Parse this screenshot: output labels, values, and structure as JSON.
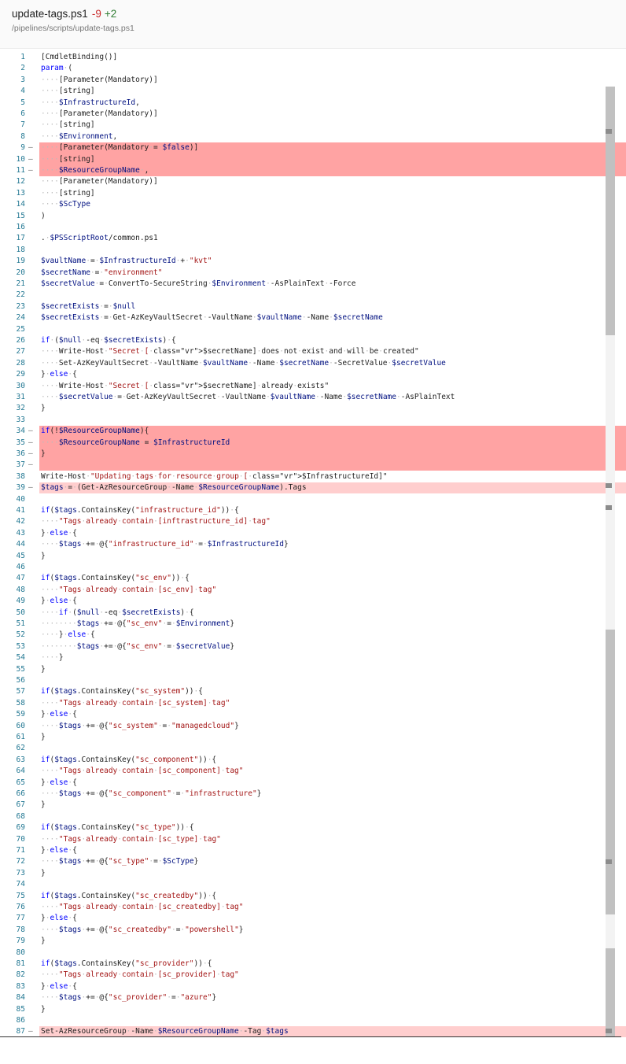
{
  "header": {
    "file_name": "update-tags.ps1",
    "deletions": "-9",
    "additions": "+2",
    "file_path": "/pipelines/scripts/update-tags.ps1"
  },
  "diff": {
    "marker_symbol": "—",
    "lines": [
      {
        "n": "1",
        "t": "[CmdletBinding()]"
      },
      {
        "n": "2",
        "t": "param ("
      },
      {
        "n": "3",
        "t": "    [Parameter(Mandatory)]"
      },
      {
        "n": "4",
        "t": "    [string]"
      },
      {
        "n": "5",
        "t": "    $InfrastructureId,"
      },
      {
        "n": "6",
        "t": "    [Parameter(Mandatory)]"
      },
      {
        "n": "7",
        "t": "    [string]"
      },
      {
        "n": "8",
        "t": "    $Environment,"
      },
      {
        "n": "9",
        "t": "    [Parameter(Mandatory = $false)]",
        "d": 1
      },
      {
        "n": "10",
        "t": "    [string]",
        "d": 1
      },
      {
        "n": "11",
        "t": "    $ResourceGroupName ,",
        "d": 1
      },
      {
        "n": "12",
        "t": "    [Parameter(Mandatory)]"
      },
      {
        "n": "13",
        "t": "    [string]"
      },
      {
        "n": "14",
        "t": "    $ScType"
      },
      {
        "n": "15",
        "t": ")"
      },
      {
        "n": "16",
        "t": ""
      },
      {
        "n": "17",
        "t": ". $PSScriptRoot/common.ps1"
      },
      {
        "n": "18",
        "t": ""
      },
      {
        "n": "19",
        "t": "$vaultName = $InfrastructureId + \"kvt\""
      },
      {
        "n": "20",
        "t": "$secretName = \"environment\""
      },
      {
        "n": "21",
        "t": "$secretValue = ConvertTo-SecureString $Environment -AsPlainText -Force"
      },
      {
        "n": "22",
        "t": ""
      },
      {
        "n": "23",
        "t": "$secretExists = $null"
      },
      {
        "n": "24",
        "t": "$secretExists = Get-AzKeyVaultSecret -VaultName $vaultName -Name $secretName"
      },
      {
        "n": "25",
        "t": ""
      },
      {
        "n": "26",
        "t": "if ($null -eq $secretExists) {"
      },
      {
        "n": "27",
        "t": "    Write-Host \"Secret [$secretName] does not exist and will be created\""
      },
      {
        "n": "28",
        "t": "    Set-AzKeyVaultSecret -VaultName $vaultName -Name $secretName -SecretValue $secretValue"
      },
      {
        "n": "29",
        "t": "} else {"
      },
      {
        "n": "30",
        "t": "    Write-Host \"Secret [$secretName] already exists\""
      },
      {
        "n": "31",
        "t": "    $secretValue = Get-AzKeyVaultSecret -VaultName $vaultName -Name $secretName -AsPlainText"
      },
      {
        "n": "32",
        "t": "}"
      },
      {
        "n": "33",
        "t": ""
      },
      {
        "n": "34",
        "t": "if(!$ResourceGroupName){",
        "d": 1
      },
      {
        "n": "35",
        "t": "    $ResourceGroupName = $InfrastructureId",
        "d": 1
      },
      {
        "n": "36",
        "t": "}",
        "d": 1
      },
      {
        "n": "37",
        "t": "",
        "d": 1
      },
      {
        "n": "38",
        "t": "Write-Host \"Updating tags for resource group [$InfrastructureId]\""
      },
      {
        "n": "39",
        "t": "$tags = (Get-AzResourceGroup -Name $ResourceGroupName).Tags",
        "d": 2
      },
      {
        "n": "40",
        "t": ""
      },
      {
        "n": "41",
        "t": "if($tags.ContainsKey(\"infrastructure_id\")) {"
      },
      {
        "n": "42",
        "t": "    \"Tags already contain [inftrastructure_id] tag\""
      },
      {
        "n": "43",
        "t": "} else {"
      },
      {
        "n": "44",
        "t": "    $tags += @{\"infrastructure_id\" = $InfrastructureId}"
      },
      {
        "n": "45",
        "t": "}"
      },
      {
        "n": "46",
        "t": ""
      },
      {
        "n": "47",
        "t": "if($tags.ContainsKey(\"sc_env\")) {"
      },
      {
        "n": "48",
        "t": "    \"Tags already contain [sc_env] tag\""
      },
      {
        "n": "49",
        "t": "} else {"
      },
      {
        "n": "50",
        "t": "    if ($null -eq $secretExists) {"
      },
      {
        "n": "51",
        "t": "        $tags += @{\"sc_env\" = $Environment}"
      },
      {
        "n": "52",
        "t": "    } else {"
      },
      {
        "n": "53",
        "t": "        $tags += @{\"sc_env\" = $secretValue}"
      },
      {
        "n": "54",
        "t": "    }"
      },
      {
        "n": "55",
        "t": "}"
      },
      {
        "n": "56",
        "t": ""
      },
      {
        "n": "57",
        "t": "if($tags.ContainsKey(\"sc_system\")) {"
      },
      {
        "n": "58",
        "t": "    \"Tags already contain [sc_system] tag\""
      },
      {
        "n": "59",
        "t": "} else {"
      },
      {
        "n": "60",
        "t": "    $tags += @{\"sc_system\" = \"managedcloud\"}"
      },
      {
        "n": "61",
        "t": "}"
      },
      {
        "n": "62",
        "t": ""
      },
      {
        "n": "63",
        "t": "if($tags.ContainsKey(\"sc_component\")) {"
      },
      {
        "n": "64",
        "t": "    \"Tags already contain [sc_component] tag\""
      },
      {
        "n": "65",
        "t": "} else {"
      },
      {
        "n": "66",
        "t": "    $tags += @{\"sc_component\" = \"infrastructure\"}"
      },
      {
        "n": "67",
        "t": "}"
      },
      {
        "n": "68",
        "t": ""
      },
      {
        "n": "69",
        "t": "if($tags.ContainsKey(\"sc_type\")) {"
      },
      {
        "n": "70",
        "t": "    \"Tags already contain [sc_type] tag\""
      },
      {
        "n": "71",
        "t": "} else {"
      },
      {
        "n": "72",
        "t": "    $tags += @{\"sc_type\" = $ScType}"
      },
      {
        "n": "73",
        "t": "}"
      },
      {
        "n": "74",
        "t": ""
      },
      {
        "n": "75",
        "t": "if($tags.ContainsKey(\"sc_createdby\")) {"
      },
      {
        "n": "76",
        "t": "    \"Tags already contain [sc_createdby] tag\""
      },
      {
        "n": "77",
        "t": "} else {"
      },
      {
        "n": "78",
        "t": "    $tags += @{\"sc_createdby\" = \"powershell\"}"
      },
      {
        "n": "79",
        "t": "}"
      },
      {
        "n": "80",
        "t": ""
      },
      {
        "n": "81",
        "t": "if($tags.ContainsKey(\"sc_provider\")) {"
      },
      {
        "n": "82",
        "t": "    \"Tags already contain [sc_provider] tag\""
      },
      {
        "n": "83",
        "t": "} else {"
      },
      {
        "n": "84",
        "t": "    $tags += @{\"sc_provider\" = \"azure\"}"
      },
      {
        "n": "85",
        "t": "}"
      },
      {
        "n": "86",
        "t": ""
      },
      {
        "n": "87",
        "t": "Set-AzResourceGroup -Name $ResourceGroupName -Tag $tags",
        "d": 2
      }
    ]
  },
  "colors": {
    "deleted_line": "#ffa3a3",
    "modified_line": "#ffcece",
    "line_number": "#237893",
    "variable": "#001080",
    "string": "#a31515",
    "keyword": "#0000ff"
  }
}
